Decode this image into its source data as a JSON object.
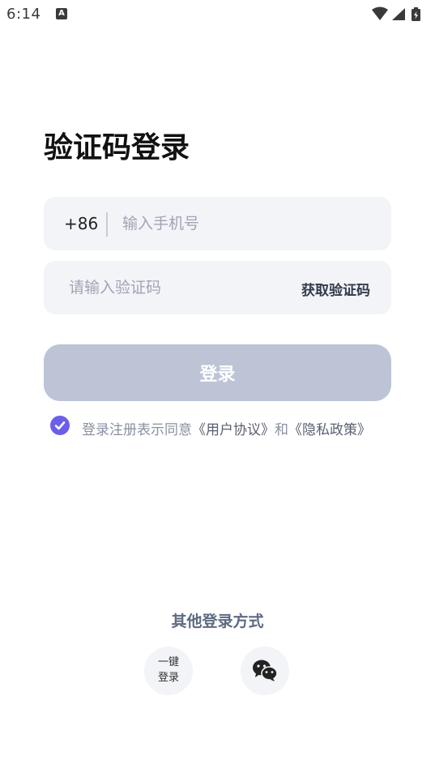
{
  "status_bar": {
    "time": "6:14"
  },
  "page_title": "验证码登录",
  "phone": {
    "country_code": "+86",
    "placeholder": "输入手机号"
  },
  "code": {
    "placeholder": "请输入验证码",
    "get_code_label": "获取验证码"
  },
  "login_button_label": "登录",
  "agreement": {
    "prefix": "登录注册表示同意",
    "user_agreement": "《用户协议》",
    "and": "和",
    "privacy_policy": "《隐私政策》",
    "checked": true
  },
  "other_login": {
    "title": "其他登录方式",
    "one_key_label": "一键\n登录",
    "wechat_icon": "wechat-icon"
  },
  "colors": {
    "accent": "#6b5fe8",
    "button_disabled": "#bcc4d6",
    "field_bg": "#f3f4f8"
  }
}
